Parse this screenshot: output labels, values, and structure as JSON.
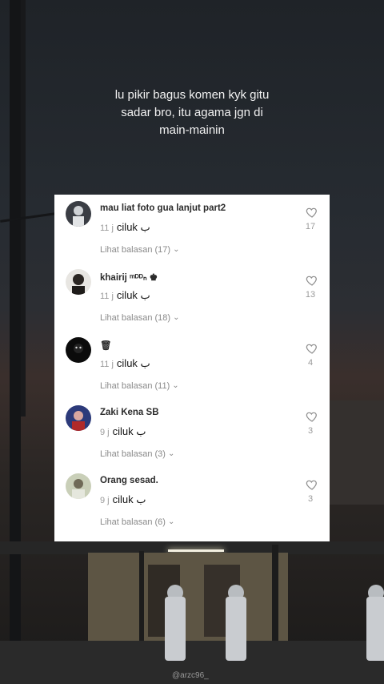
{
  "headline": {
    "line1": "lu pikir bagus komen kyk gitu",
    "line2": "sadar bro, itu agama jgn di",
    "line3": "main-mainin"
  },
  "comments": [
    {
      "username": "mau liat foto gua lanjut part2",
      "time": "11 j",
      "text": "ciluk ب",
      "replies": "Lihat balasan (17)",
      "likes": "17"
    },
    {
      "username": "khairij ᵐᴰᴰₙ ♚",
      "time": "11 j",
      "text": "ciluk ب",
      "replies": "Lihat balasan (18)",
      "likes": "13"
    },
    {
      "username": "🗑",
      "time": "11 j",
      "text": "ciluk ب",
      "replies": "Lihat balasan (11)",
      "likes": "4"
    },
    {
      "username": "Zaki Kena SB",
      "time": "9 j",
      "text": "ciluk ب",
      "replies": "Lihat balasan (3)",
      "likes": "3"
    },
    {
      "username": "Orang sesad.",
      "time": "9 j",
      "text": "ciluk ب",
      "replies": "Lihat balasan (6)",
      "likes": "3"
    }
  ],
  "watermark": "@arzc96_",
  "colors": {
    "panel_bg": "#ffffff",
    "muted": "#9a9a9a"
  }
}
